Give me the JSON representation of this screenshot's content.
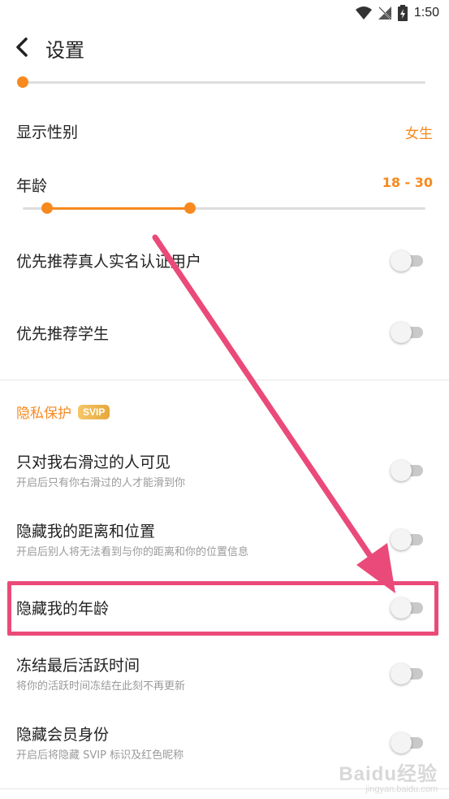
{
  "status_bar": {
    "time": "1:50",
    "icons": [
      "wifi-icon",
      "no-signal-icon",
      "battery-icon"
    ]
  },
  "header": {
    "title": "设置",
    "back_icon": "chevron-left-icon"
  },
  "distance": {
    "level": 0.0
  },
  "gender": {
    "label": "显示性别",
    "value": "女生"
  },
  "age": {
    "label": "年龄",
    "value": "18 - 30",
    "range_fraction": [
      0.06,
      0.415
    ]
  },
  "toggles_top": [
    {
      "label": "优先推荐真人实名认证用户",
      "on": false
    },
    {
      "label": "优先推荐学生",
      "on": false
    }
  ],
  "privacy": {
    "section_title": "隐私保护",
    "badge": "SVIP",
    "items": [
      {
        "label": "只对我右滑过的人可见",
        "sub": "开启后只有你右滑过的人才能滑到你",
        "on": false
      },
      {
        "label": "隐藏我的距离和位置",
        "sub": "开启后别人将无法看到与你的距离和你的位置信息",
        "on": false
      },
      {
        "label": "隐藏我的年龄",
        "sub": "",
        "on": false,
        "highlighted": true
      },
      {
        "label": "冻结最后活跃时间",
        "sub": "将你的活跃时间冻结在此刻不再更新",
        "on": false
      },
      {
        "label": "隐藏会员身份",
        "sub": "开启后将隐藏 SVIP 标识及红色昵称",
        "on": false
      }
    ]
  },
  "colors": {
    "accent": "#f7891f",
    "highlight": "#ea4a79"
  },
  "watermark": {
    "main": "Baidu经验",
    "sub": "jingyan.baidu.com"
  }
}
